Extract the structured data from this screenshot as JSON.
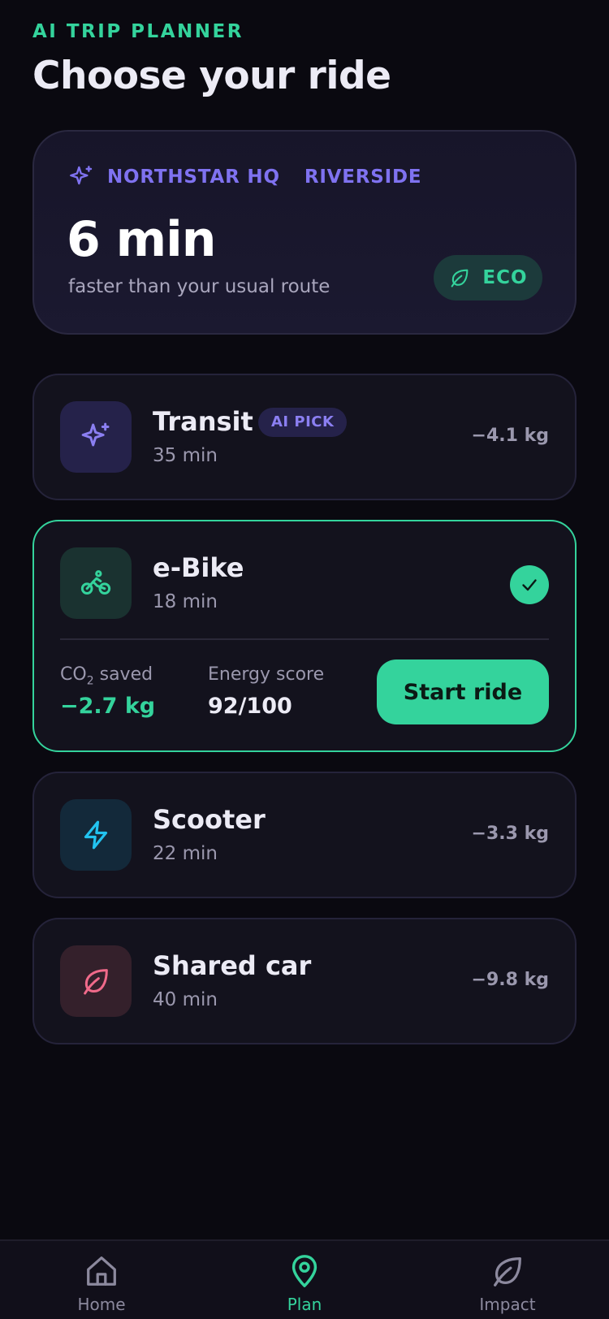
{
  "header": {
    "eyebrow": "AI TRIP PLANNER",
    "title": "Choose your ride"
  },
  "summary": {
    "origin": "NORTHSTAR HQ",
    "destination": "RIVERSIDE",
    "time_saved": "6 min",
    "subtitle": "faster than your usual route",
    "badge": "ECO",
    "icons": {
      "route": "sparkle-icon",
      "badge": "leaf-icon"
    }
  },
  "options": [
    {
      "name": "Transit",
      "time": "35 min",
      "co2": "−4.1 kg",
      "tag": "AI PICK",
      "icon": "sparkle-icon",
      "accent": "#8b7ff2"
    },
    {
      "name": "e-Bike",
      "time": "18 min",
      "icon": "bike-icon",
      "accent": "#34d39c",
      "selected": true,
      "co2_label": "CO",
      "co2_label_sub": "2",
      "co2_label_suffix": " saved",
      "co2_value": "−2.7 kg",
      "energy_label": "Energy score",
      "energy_value": "92/100",
      "cta": "Start ride"
    },
    {
      "name": "Scooter",
      "time": "22 min",
      "co2": "−3.3 kg",
      "icon": "lightning-icon",
      "accent": "#22c3f0"
    },
    {
      "name": "Shared car",
      "time": "40 min",
      "co2": "−9.8 kg",
      "icon": "leaf-icon",
      "accent": "#f06a8a"
    }
  ],
  "nav": [
    {
      "label": "Home",
      "icon": "home-icon",
      "active": false
    },
    {
      "label": "Plan",
      "icon": "map-pin-icon",
      "active": true
    },
    {
      "label": "Impact",
      "icon": "leaf-icon",
      "active": false
    }
  ],
  "colors": {
    "accent_green": "#34d39c",
    "accent_purple": "#7f72f0",
    "background": "#0a0910",
    "card": "#13121d"
  }
}
